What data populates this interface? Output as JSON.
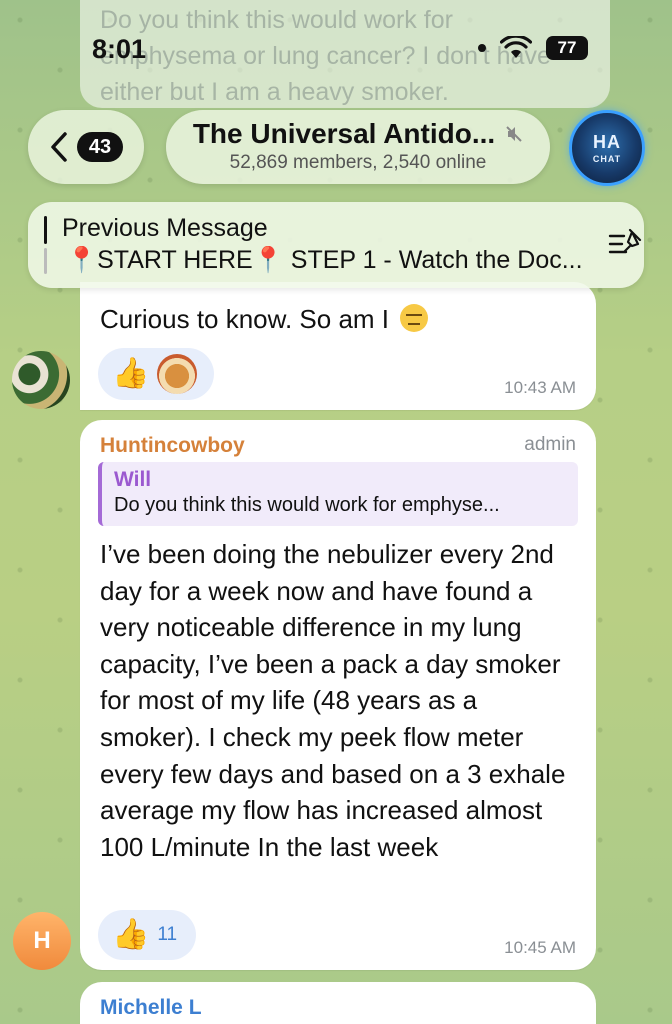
{
  "status_bar": {
    "time": "8:01",
    "battery": "77"
  },
  "header": {
    "back_badge": "43",
    "title": "The Universal Antido...",
    "subtitle": "52,869 members, 2,540 online",
    "avatar_logo": "HA",
    "avatar_caption": "CHAT"
  },
  "ghost_message": {
    "text": "Do you think this would work for emphysema or lung cancer? I don't have either but I am a heavy smoker."
  },
  "pinned": {
    "title": "Previous Message",
    "text": "📍START HERE📍 STEP 1 - Watch the Doc..."
  },
  "messages": [
    {
      "text": "Curious to know. So am I",
      "reaction": "👍",
      "time": "10:43 AM"
    },
    {
      "sender": "Huntincowboy",
      "role": "admin",
      "reply_author": "Will",
      "reply_text": "Do you think this would work for emphyse...",
      "body": "I’ve been doing the nebulizer every 2nd day for a week now and have found a very noticeable difference in my lung capacity, I’ve been a pack a day smoker for most of my life (48 years as a smoker). I check my peek flow meter every few days and based on a 3 exhale average my flow has increased almost 100 L/minute In the last week",
      "reaction": "👍",
      "reaction_count": "11",
      "time": "10:45 AM",
      "avatar_initial": "H"
    },
    {
      "sender": "Michelle L"
    }
  ]
}
